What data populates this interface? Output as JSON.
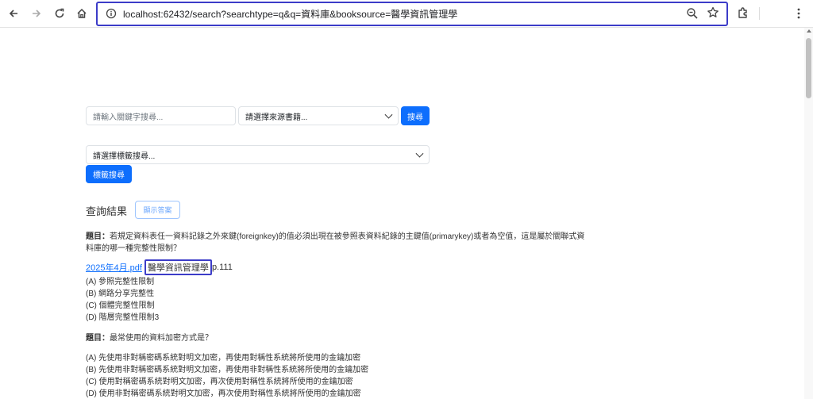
{
  "browser": {
    "url": "localhost:62432/search?searchtype=q&q=資料庫&booksource=醫學資訊管理學"
  },
  "search": {
    "keyword_placeholder": "請輸入關鍵字搜尋...",
    "source_select_value": "請選擇來源書籍...",
    "search_button": "搜尋",
    "tag_select_value": "請選擇標籤搜尋...",
    "tag_search_button": "標籤搜尋"
  },
  "results": {
    "title": "查詢結果",
    "show_answer_button": "顯示答案",
    "questions": [
      {
        "label": "題目：",
        "text_line1": "若規定資料表任一資料記錄之外來鍵(foreignkey)的值必須出現在被參照表資料紀錄的主鍵值(primarykey)或者為空值，這是屬於關聯式資",
        "text_line2": "料庫的哪一種完整性限制？",
        "source_link": "2025年4月.pdf",
        "source_book": "醫學資訊管理學",
        "source_page": "p.111",
        "options": [
          "(A) 參照完整性限制",
          "(B) 網路分享完整性",
          "(C) 個體完整性限制",
          "(D) 階層完整性限制3"
        ]
      },
      {
        "label": "題目：",
        "text_line1": "最常使用的資料加密方式是？",
        "options": [
          "(A) 先使用非對稱密碼系統對明文加密，再使用對稱性系統將所使用的金鑰加密",
          "(B) 先使用非對稱密碼系統對明文加密，再使用非對稱性系統將所使用的金鑰加密",
          "(C) 使用對稱密碼系統對明文加密，再次使用對稱性系統將所使用的金鑰加密",
          "(D) 使用非對稱密碼系統對明文加密，再次使用對稱性系統將所使用的金鑰加密"
        ]
      }
    ]
  },
  "colors": {
    "primary": "#0d6efd",
    "highlight_border": "#3c3cc8"
  }
}
